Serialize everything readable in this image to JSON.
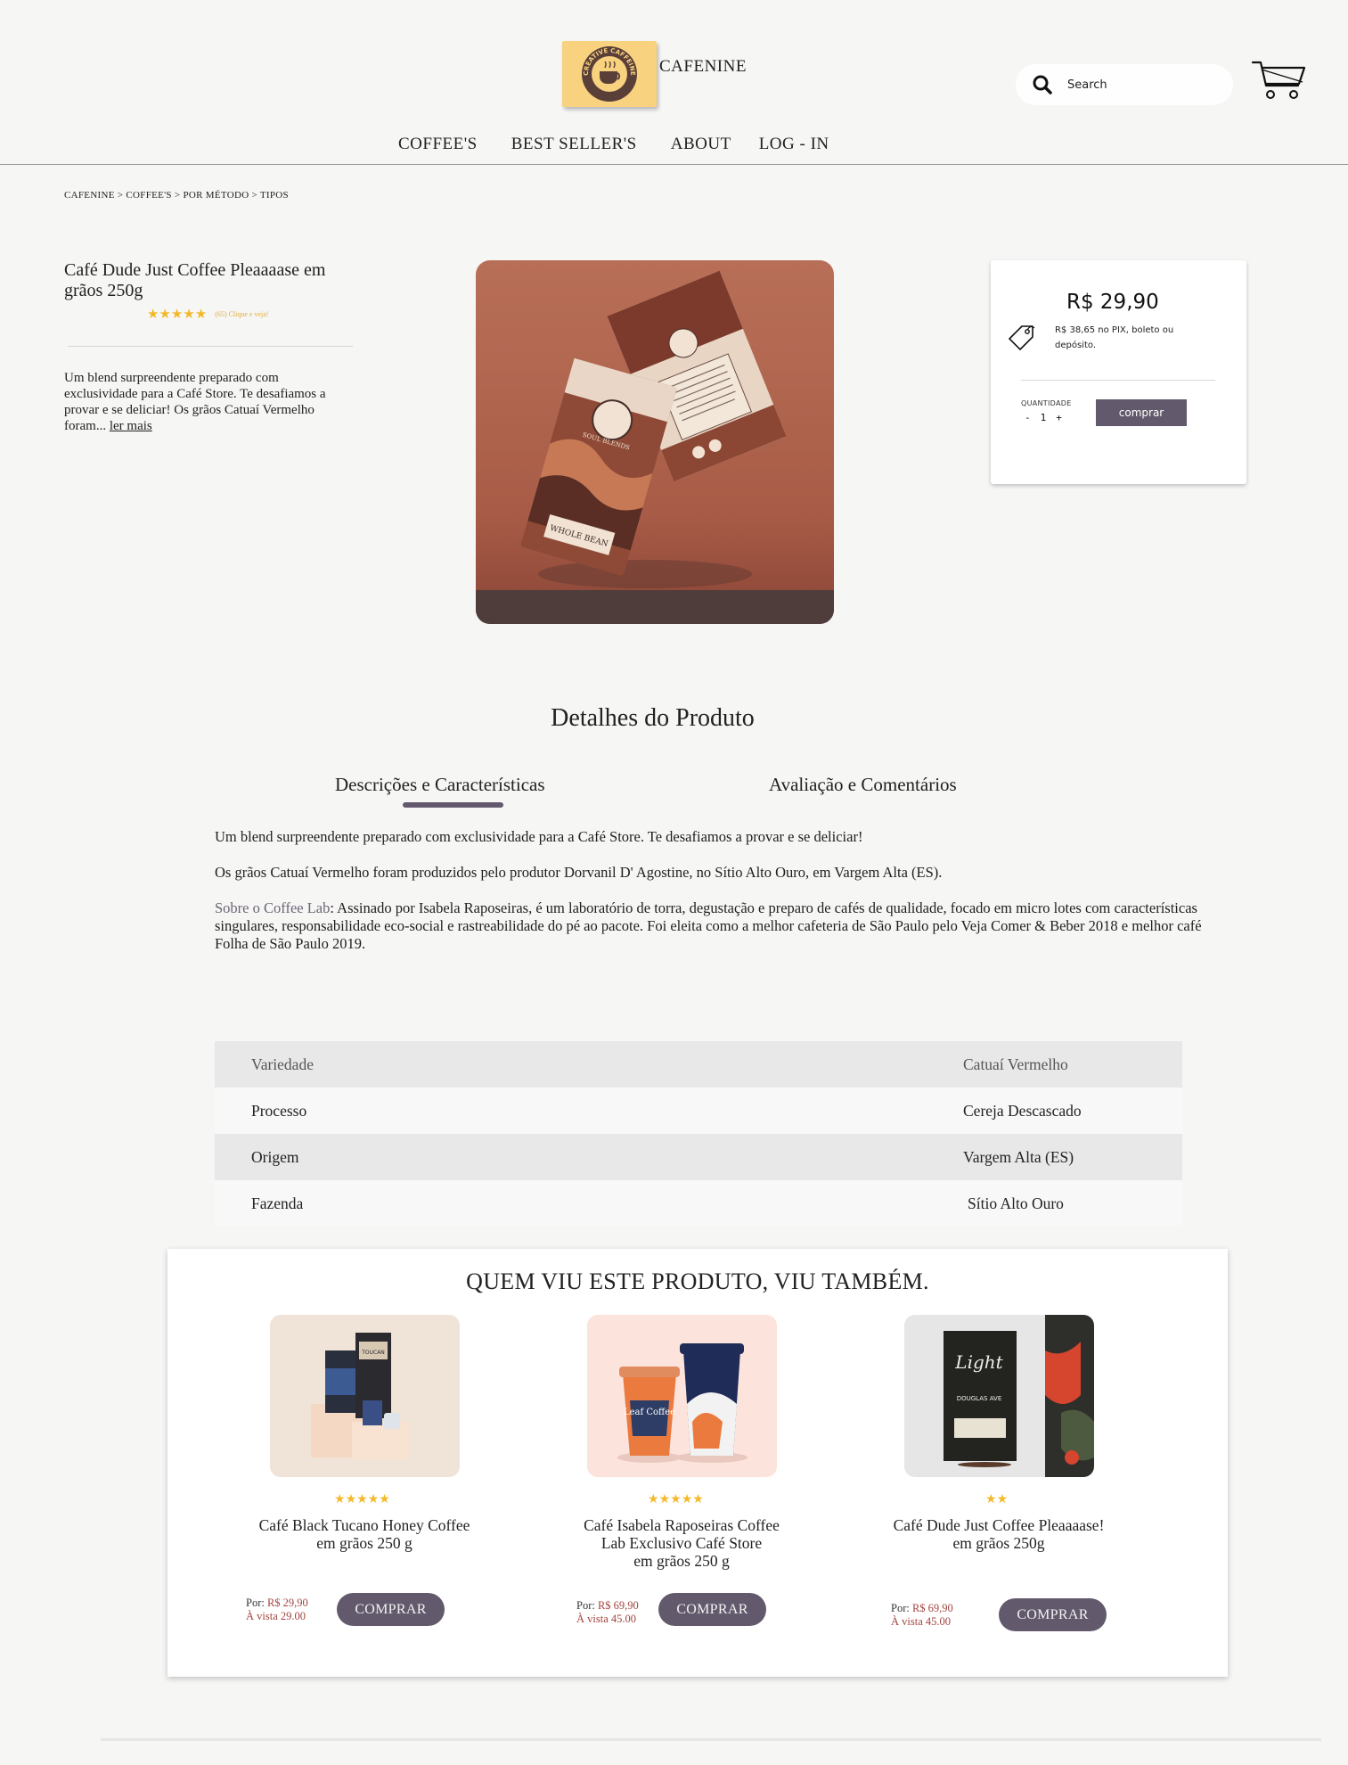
{
  "header": {
    "brand": "CAFENINE",
    "logo_text": "CREATIVE CAFFEINE",
    "search_placeholder": "Search",
    "nav": [
      "COFFEE'S",
      "BEST SELLER'S",
      "ABOUT",
      "LOG - IN"
    ]
  },
  "breadcrumb": "CAFENINE > COFFEE'S > POR MÉTODO > TIPOS",
  "product": {
    "title": "Café Dude Just Coffee Pleaaaase em grãos 250g",
    "rating": 5,
    "reviews_link": "(65) Clique e veja!",
    "short_description": "Um blend surpreendente preparado com exclusividade para a Café Store. Te desafiamos a provar e se deliciar! Os grãos Catuaí Vermelho foram...",
    "read_more": "ler mais",
    "package_labels": [
      "SOUL BLENDS",
      "WHOLE BEAN"
    ]
  },
  "price_card": {
    "price": "R$ 29,90",
    "note": "R$ 38,65 no PIX, boleto ou depósito.",
    "quantity_label": "QUANTIDADE",
    "minus": "-",
    "quantity": "1",
    "plus": "+",
    "buy_label": "comprar"
  },
  "details": {
    "title": "Detalhes do Produto",
    "tabs": [
      "Descrições e Características",
      "Avaliação e Comentários"
    ],
    "paragraph_1": "Um blend surpreendente preparado com exclusividade para a Café Store. Te desafiamos a provar e se deliciar!",
    "paragraph_2": "Os grãos Catuaí Vermelho foram produzidos pelo produtor Dorvanil D' Agostine, no Sítio Alto Ouro, em Vargem Alta (ES).",
    "lab_link": "Sobre o Coffee Lab",
    "paragraph_3": ": Assinado por Isabela Raposeiras, é um laboratório de torra, degustação e preparo de cafés de qualidade, focado em micro lotes com características singulares, responsabilidade eco-social e rastreabilidade do pé ao pacote. Foi eleita como a melhor cafeteria de São Paulo pelo Veja Comer & Beber 2018 e melhor café Folha de São Paulo 2019."
  },
  "specs": [
    {
      "key": "Variedade",
      "value": "Catuaí Vermelho"
    },
    {
      "key": "Processo",
      "value": "Cereja Descascado"
    },
    {
      "key": "Origem",
      "value": "Vargem Alta (ES)"
    },
    {
      "key": "Fazenda",
      "value": "Sítio Alto Ouro"
    }
  ],
  "related": {
    "title": "QUEM VIU ESTE PRODUTO, VIU TAMBÉM.",
    "items": [
      {
        "name_1": "Café Black Tucano Honey Coffee",
        "name_2": "em grãos 250 g",
        "name_3": "",
        "rating": 5,
        "price_prefix": "Por: ",
        "price": "R$ 29,90",
        "cash": "À vista 29.00",
        "button": "COMPRAR",
        "image_text": "TOUCAN"
      },
      {
        "name_1": "Café Isabela Raposeiras Coffee",
        "name_2": "Lab Exclusivo Café Store",
        "name_3": "em grãos 250 g",
        "rating": 5,
        "price_prefix": "Por: ",
        "price": "R$ 69,90",
        "cash": "À vista 45.00",
        "button": "COMPRAR",
        "image_text": "Leaf Coffee"
      },
      {
        "name_1": "Café Dude Just Coffee Pleaaaase!",
        "name_2": "em grãos 250g",
        "name_3": "",
        "rating": 2,
        "price_prefix": "Por: ",
        "price": "R$ 69,90",
        "cash": "À vista 45.00",
        "button": "COMPRAR",
        "image_text": "Light",
        "image_subtext": "DOUGLAS AVE"
      }
    ]
  },
  "colors": {
    "accent": "#625a6c",
    "logo_bg": "#f8d27f",
    "star": "#f3b92a",
    "price_red": "#a1443f"
  }
}
